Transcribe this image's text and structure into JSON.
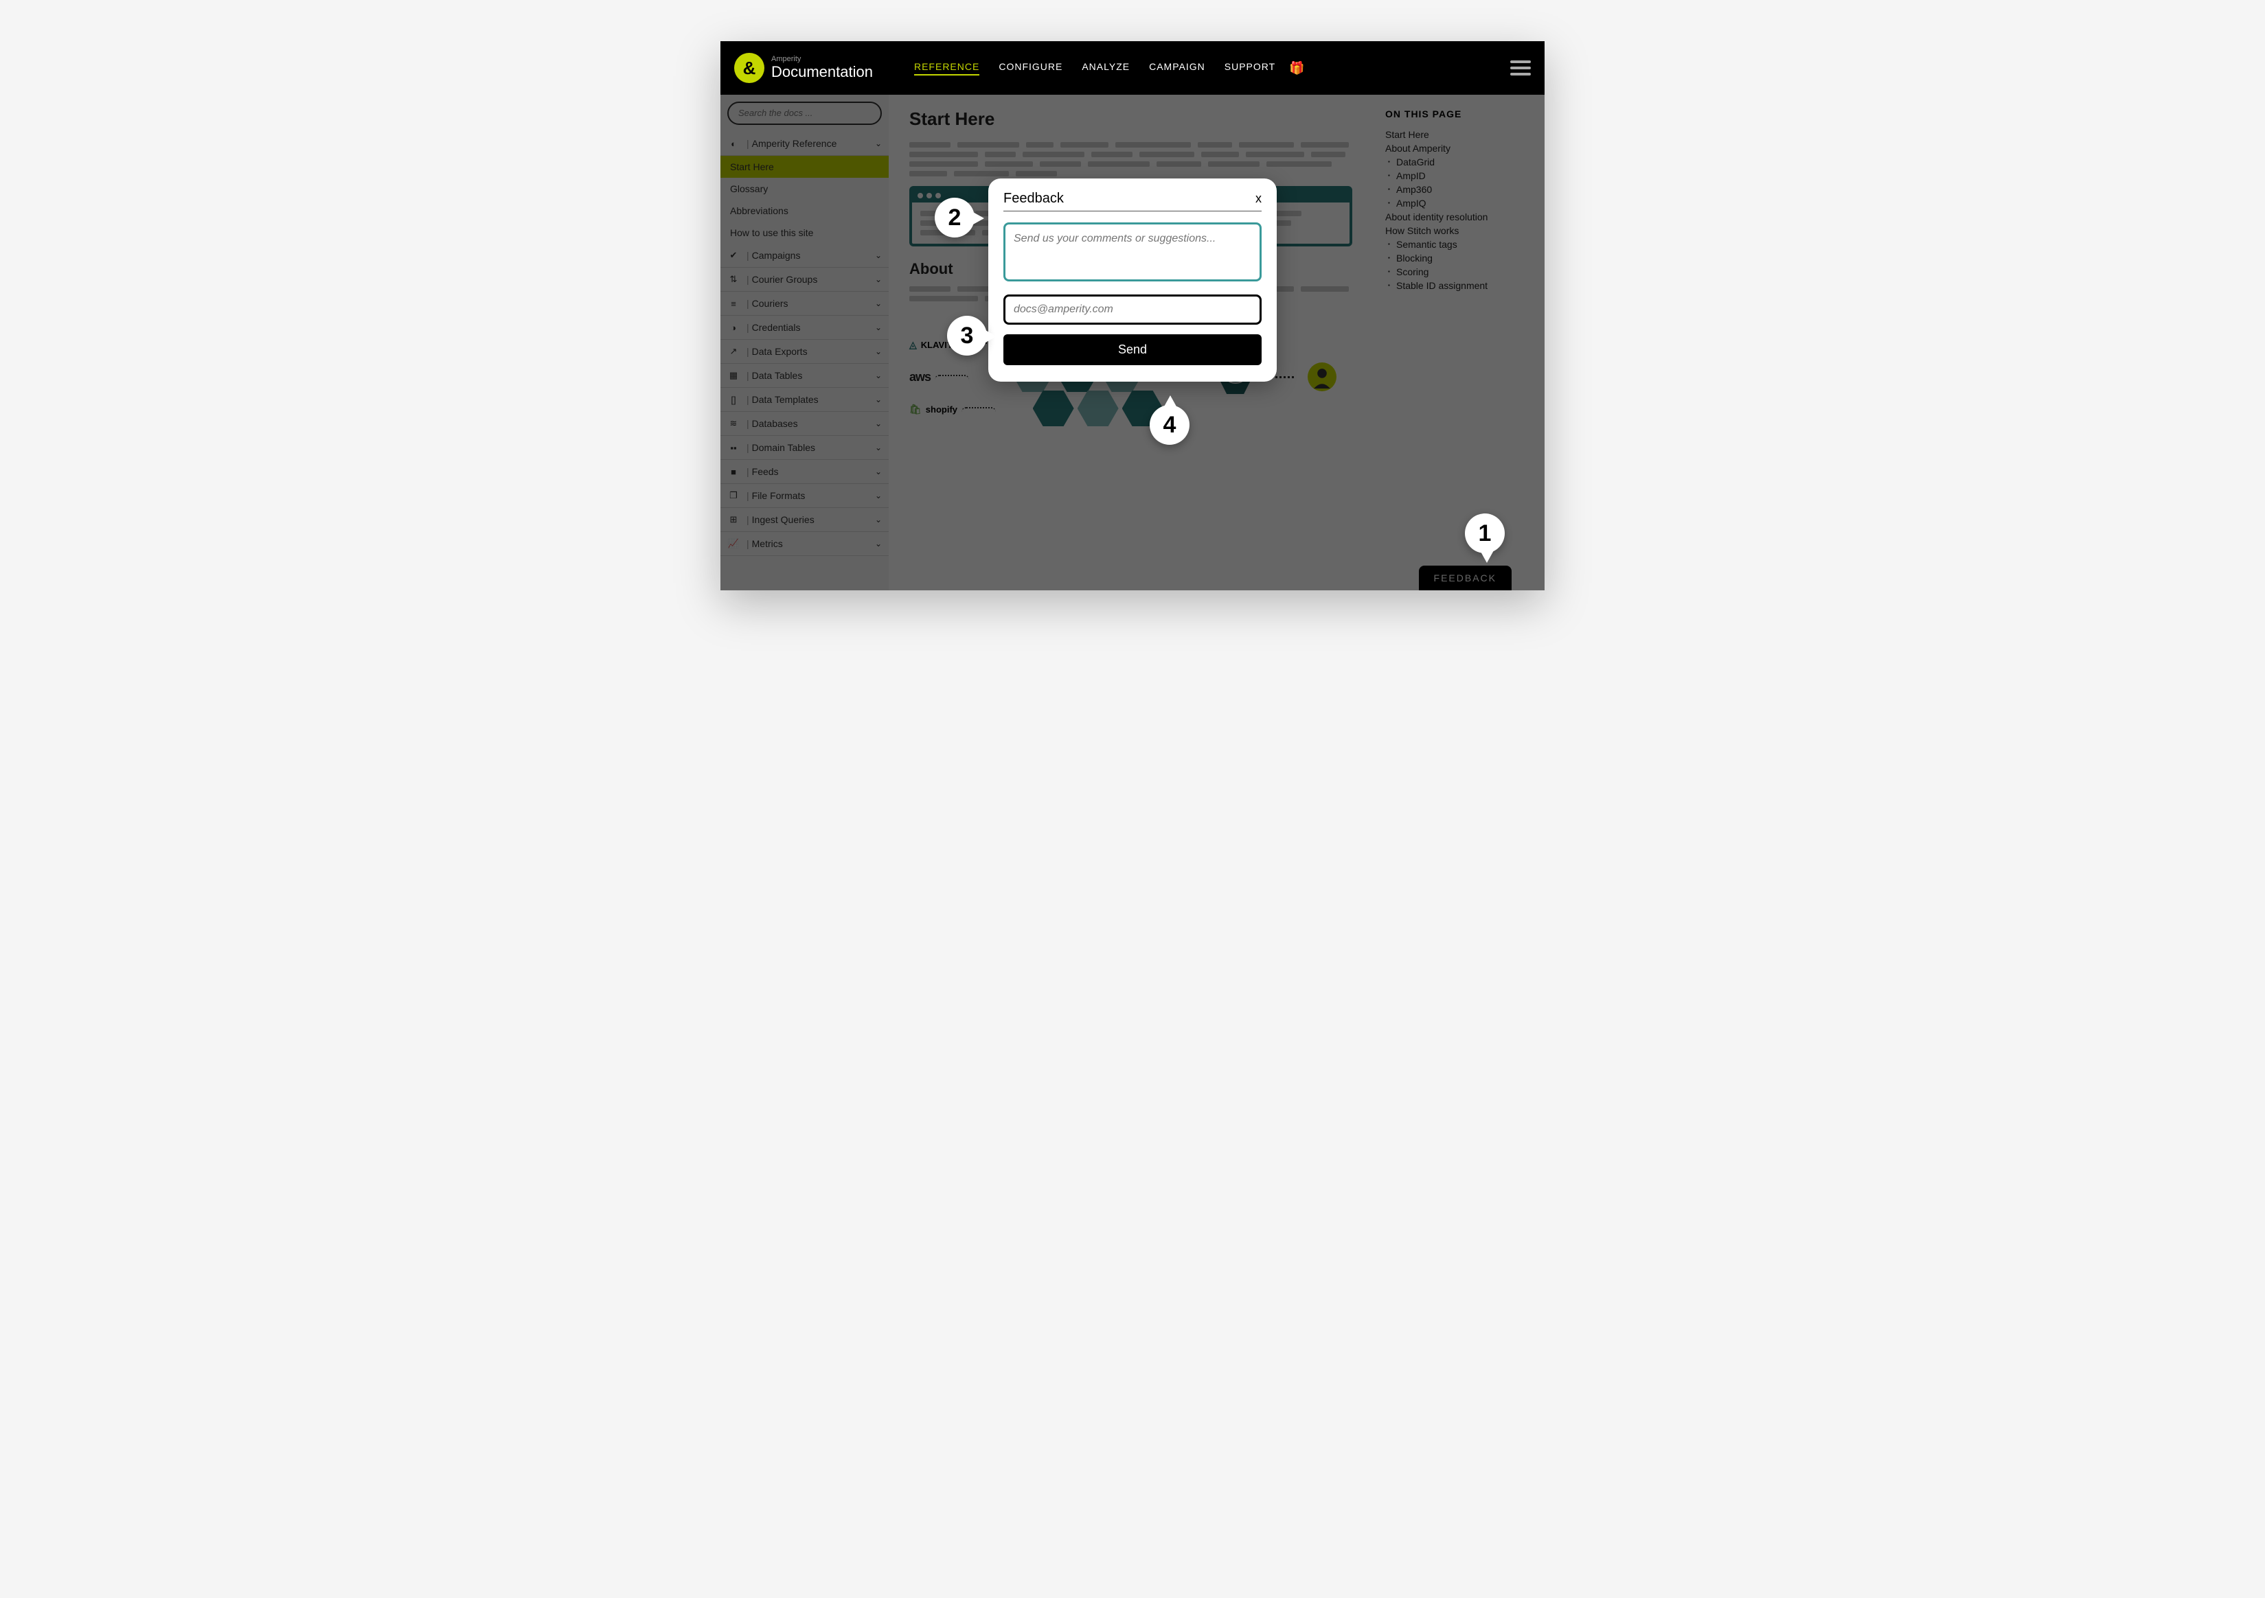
{
  "brand": {
    "small": "Amperity",
    "big": "Documentation"
  },
  "nav": {
    "reference": "REFERENCE",
    "configure": "CONFIGURE",
    "analyze": "ANALYZE",
    "campaign": "CAMPAIGN",
    "support": "SUPPORT"
  },
  "search": {
    "placeholder": "Search the docs ..."
  },
  "sidebar": {
    "top_section": "Amperity Reference",
    "subs": [
      "Start Here",
      "Glossary",
      "Abbreviations",
      "How to use this site"
    ],
    "sections": [
      {
        "icon": "✔",
        "label": "Campaigns"
      },
      {
        "icon": "⇅",
        "label": "Courier Groups"
      },
      {
        "icon": "≡",
        "label": "Couriers"
      },
      {
        "icon": "◑",
        "label": "Credentials"
      },
      {
        "icon": "↗",
        "label": "Data Exports"
      },
      {
        "icon": "▦",
        "label": "Data Tables"
      },
      {
        "icon": "[]",
        "label": "Data Templates"
      },
      {
        "icon": "≋",
        "label": "Databases"
      },
      {
        "icon": "▪▪",
        "label": "Domain Tables"
      },
      {
        "icon": "■",
        "label": "Feeds"
      },
      {
        "icon": "❐",
        "label": "File Formats"
      },
      {
        "icon": "⊞",
        "label": "Ingest Queries"
      },
      {
        "icon": "📈",
        "label": "Metrics"
      }
    ]
  },
  "main": {
    "h1": "Start Here",
    "h2": "About"
  },
  "partners": {
    "klaviyo": "KLAVIYO",
    "aws": "aws",
    "shopify": "shopify"
  },
  "toc": {
    "title": "ON THIS PAGE",
    "items": [
      {
        "label": "Start Here",
        "indent": false
      },
      {
        "label": "About Amperity",
        "indent": false
      },
      {
        "label": "DataGrid",
        "indent": true
      },
      {
        "label": "AmpID",
        "indent": true
      },
      {
        "label": "Amp360",
        "indent": true
      },
      {
        "label": "AmpIQ",
        "indent": true
      },
      {
        "label": "About identity resolution",
        "indent": false
      },
      {
        "label": "How Stitch works",
        "indent": false
      },
      {
        "label": "Semantic tags",
        "indent": true
      },
      {
        "label": "Blocking",
        "indent": true
      },
      {
        "label": "Scoring",
        "indent": true
      },
      {
        "label": "Stable ID assignment",
        "indent": true
      }
    ]
  },
  "modal": {
    "title": "Feedback",
    "close": "x",
    "comment_placeholder": "Send us your comments or suggestions...",
    "email_placeholder": "docs@amperity.com",
    "send": "Send"
  },
  "feedback_button": "FEEDBACK",
  "callouts": {
    "c1": "1",
    "c2": "2",
    "c3": "3",
    "c4": "4"
  }
}
